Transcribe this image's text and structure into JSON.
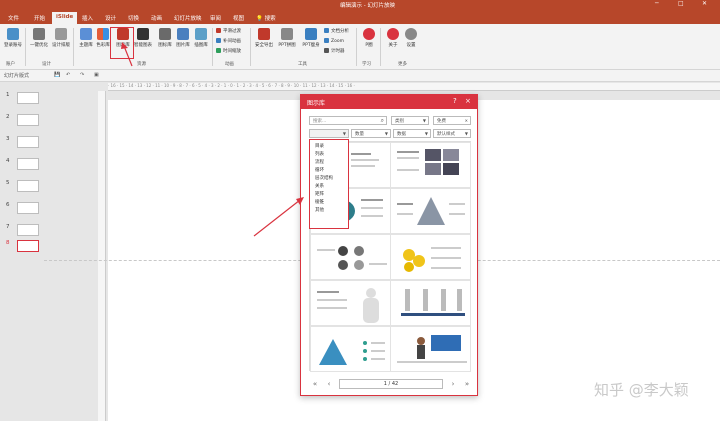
{
  "titlebar": {
    "title": "编辑演示 - 幻灯片放映"
  },
  "tabs": [
    "文件",
    "开始",
    "iSlide",
    "插入",
    "设计",
    "切换",
    "动画",
    "幻灯片放映",
    "审阅",
    "视图"
  ],
  "active_tab": "iSlide",
  "tell_me": "搜索",
  "ribbon": {
    "b_account": "登录账号",
    "b_onekey": "一键优化",
    "b_design": "设计排版",
    "b_theme": "主题库",
    "b_color": "色彩库",
    "b_diagram": "图示库",
    "b_chart": "智能图表",
    "b_icon": "图标库",
    "b_image": "图片库",
    "b_illus": "插图库",
    "s_smooth": "平滑过渡",
    "s_color": "补间动画",
    "s_time": "时间缩放",
    "b_secure": "安全导出",
    "b_ppt2img": "PPT拼图",
    "b_pptanalysis": "PPT瘦身",
    "s_doc": "文档分析",
    "s_zoom": "Zoom",
    "s_timer": "计时器",
    "b_p": "P圈",
    "b_about": "关于",
    "b_settings": "设置",
    "g_account": "账户",
    "g_design": "设计",
    "g_resources": "资源",
    "g_anim": "动画",
    "g_tools": "工具",
    "g_learn": "学习",
    "g_more": "更多"
  },
  "qat": {
    "zoom_label": "幻灯片版式"
  },
  "ruler": "· 16 · 15 · 14 · 13 · 12 · 11 · 10 · 9 · 8 · 7 · 6 · 5 · 4 · 3 · 2 · 1 · 0 · 1 · 2 · 3 · 4 · 5 · 6 · 7 · 8 · 9 · 10 · 11 · 12 · 13 · 14 · 15 · 16 ·",
  "slides": [
    "1",
    "2",
    "3",
    "4",
    "5",
    "6",
    "7",
    "8"
  ],
  "dialog": {
    "title": "图示库",
    "search_placeholder": "搜索...",
    "dd1": "类别",
    "dd2": "免费",
    "dd3": "",
    "dd4": "数量",
    "dd5": "数据",
    "dd6": "默认样式",
    "page": "1 / 42"
  },
  "menu_items": [
    "目录",
    "列表",
    "流程",
    "循环",
    "层次结构",
    "关系",
    "矩阵",
    "棱锥",
    "其他"
  ],
  "watermark": "知乎 @李大颖",
  "colors": {
    "brand": "#b7472a",
    "accent": "#d9333f"
  }
}
